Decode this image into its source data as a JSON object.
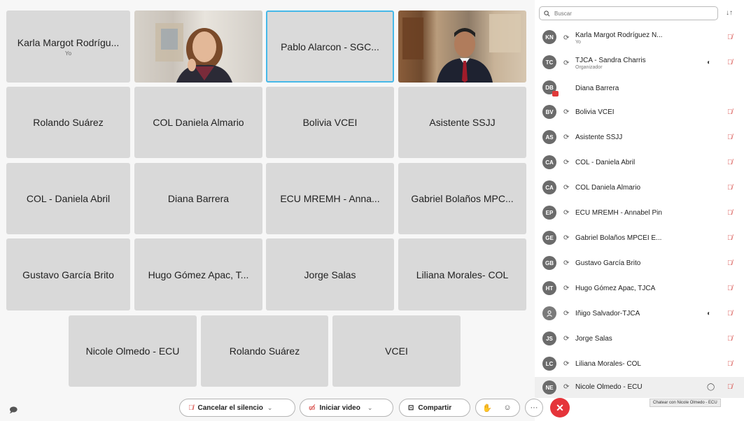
{
  "tiles": [
    {
      "name": "Karla Margot Rodrígu...",
      "sub": "Yo"
    },
    {
      "name": "Pablo Alarcon - SGC..."
    },
    {
      "name": "Rolando Suárez"
    },
    {
      "name": "COL Daniela Almario"
    },
    {
      "name": "Bolivia VCEI"
    },
    {
      "name": "Asistente SSJJ"
    },
    {
      "name": "COL - Daniela Abril"
    },
    {
      "name": "Diana Barrera"
    },
    {
      "name": "ECU MREMH - Anna..."
    },
    {
      "name": "Gabriel Bolaños MPC..."
    },
    {
      "name": "Gustavo García Brito"
    },
    {
      "name": "Hugo Gómez Apac, T..."
    },
    {
      "name": "Jorge Salas"
    },
    {
      "name": "Liliana Morales- COL"
    },
    {
      "name": "Nicole Olmedo - ECU"
    },
    {
      "name": "Rolando Suárez"
    },
    {
      "name": "VCEI"
    }
  ],
  "search": {
    "placeholder": "Buscar"
  },
  "participants": [
    {
      "initials": "KN",
      "name": "Karla Margot Rodríguez N...",
      "role": "Yo"
    },
    {
      "initials": "TC",
      "name": "TJCA - Sandra Charris",
      "role": "Organizador"
    },
    {
      "initials": "DB",
      "name": "Diana Barrera"
    },
    {
      "initials": "BV",
      "name": "Bolivia VCEI"
    },
    {
      "initials": "AS",
      "name": "Asistente SSJJ"
    },
    {
      "initials": "CA",
      "name": "COL - Daniela Abril"
    },
    {
      "initials": "CA",
      "name": "COL Daniela Almario"
    },
    {
      "initials": "EP",
      "name": "ECU MREMH - Annabel Pin"
    },
    {
      "initials": "GE",
      "name": "Gabriel Bolaños MPCEI E..."
    },
    {
      "initials": "GB",
      "name": "Gustavo García Brito"
    },
    {
      "initials": "HT",
      "name": "Hugo Gómez Apac, TJCA"
    },
    {
      "initials": "",
      "name": "Iñigo Salvador-TJCA"
    },
    {
      "initials": "JS",
      "name": "Jorge Salas"
    },
    {
      "initials": "LC",
      "name": "Liliana Morales- COL"
    },
    {
      "initials": "NE",
      "name": "Nicole Olmedo - ECU"
    }
  ],
  "tooltip": "Chatear con Nicole Olmedo - ECU",
  "toolbar": {
    "mute_label": "Cancelar el silencio",
    "video_label": "Iniciar video",
    "share_label": "Compartir",
    "more_label": "···"
  },
  "colors": {
    "end_call": "#e5343a",
    "active_speaker": "#46b8e8",
    "muted": "#d9534f"
  }
}
